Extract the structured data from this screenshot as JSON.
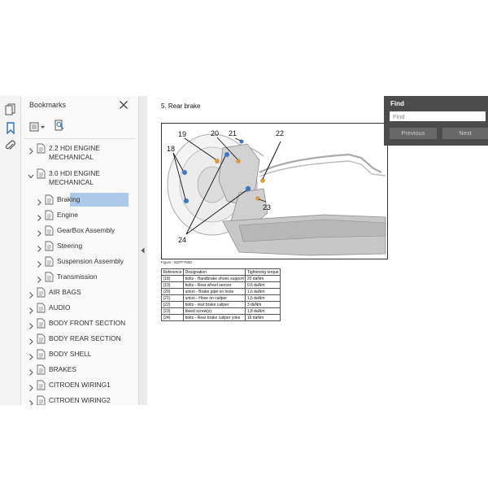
{
  "toolbar": {
    "icons": [
      "pages-icon",
      "bookmark-icon",
      "attachment-icon"
    ]
  },
  "bookmarks": {
    "title": "Bookmarks",
    "items": [
      {
        "label": "2.2 HDI ENGINE",
        "label2": "MECHANICAL",
        "level": 0,
        "expanded": false
      },
      {
        "label": "3.0 HDI ENGINE",
        "label2": "MECHANICAL",
        "level": 0,
        "expanded": true
      },
      {
        "label": "Braking",
        "level": 1,
        "expanded": false,
        "selected": true
      },
      {
        "label": "Engine",
        "level": 1,
        "expanded": false
      },
      {
        "label": "GearBox Assembly",
        "level": 1,
        "expanded": false
      },
      {
        "label": "Steering",
        "level": 1,
        "expanded": false
      },
      {
        "label": "Suspension Assembly",
        "level": 1,
        "expanded": false
      },
      {
        "label": "Transmission",
        "level": 1,
        "expanded": false
      },
      {
        "label": "AIR BAGS",
        "level": 0,
        "expanded": false
      },
      {
        "label": "AUDIO",
        "level": 0,
        "expanded": false
      },
      {
        "label": "BODY FRONT SECTION",
        "level": 0,
        "expanded": false
      },
      {
        "label": "BODY REAR SECTION",
        "level": 0,
        "expanded": false
      },
      {
        "label": "BODY SHELL",
        "level": 0,
        "expanded": false
      },
      {
        "label": "BRAKES",
        "level": 0,
        "expanded": false
      },
      {
        "label": "CITROEN WIRING1",
        "level": 0,
        "expanded": false
      },
      {
        "label": "CITROEN WIRING2",
        "level": 0,
        "expanded": false
      }
    ]
  },
  "document": {
    "title": "5. Rear brake",
    "figure_caption": "Figure : B3FP7N6D",
    "callouts": [
      "18",
      "19",
      "20",
      "21",
      "22",
      "23",
      "24"
    ],
    "table": {
      "headers": [
        "Reference",
        "Designation",
        "Tightening torque"
      ],
      "rows": [
        [
          "(18)",
          "bolts - Handbrake shoes support",
          "20 daNm"
        ],
        [
          "(19)",
          "bolts - Rear wheel sensor",
          "0,6 daNm"
        ],
        [
          "(20)",
          "union - Brake pipe on hose",
          "1,6 daNm"
        ],
        [
          "(21)",
          "union - Hose on caliper",
          "1,6 daNm"
        ],
        [
          "(22)",
          "bolts - rear brake caliper",
          "3 daNm"
        ],
        [
          "(23)",
          "bleed screw(s)",
          "1,8 daNm"
        ],
        [
          "(24)",
          "bolts - Rear brake caliper yoke",
          "16 daNm"
        ]
      ]
    }
  },
  "find": {
    "title": "Find",
    "placeholder": "Find",
    "previous_label": "Previous",
    "next_label": "Next"
  },
  "colors": {
    "selection": "#acc9e8",
    "find_background": "#4b4b4b",
    "accent_icon": "#2b6fc2"
  }
}
